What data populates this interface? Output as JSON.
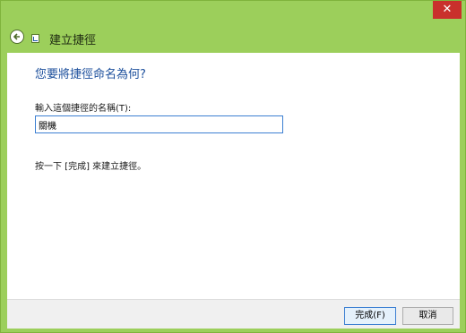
{
  "window": {
    "close_label": "✕"
  },
  "nav": {
    "title": "建立捷徑",
    "back_icon": "back-arrow-icon",
    "wizard_icon": "shortcut-icon"
  },
  "main": {
    "heading": "您要將捷徑命名為何?",
    "field_label": "輸入這個捷徑的名稱(T):",
    "name_value": "關機",
    "hint": "按一下 [完成] 來建立捷徑。"
  },
  "footer": {
    "finish_label": "完成(F)",
    "cancel_label": "取消"
  },
  "colors": {
    "frame": "#9ccf5b",
    "accent": "#1c4f9c",
    "close": "#c9302c",
    "focus_border": "#3c7fd2"
  }
}
